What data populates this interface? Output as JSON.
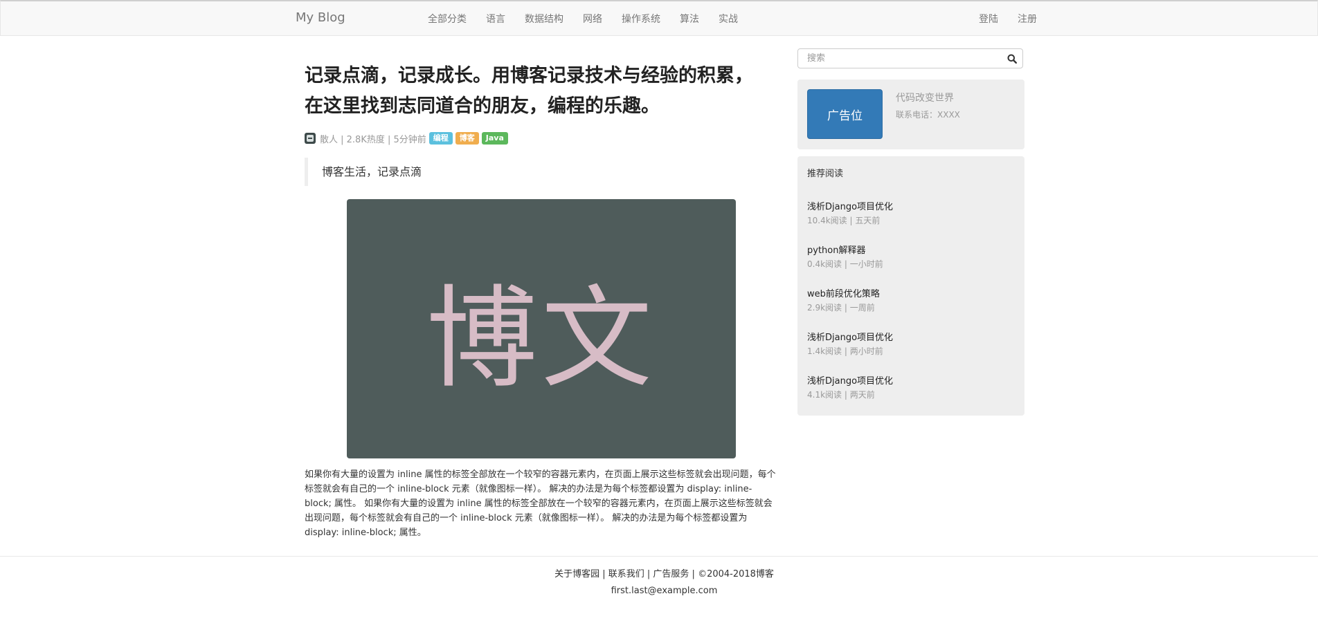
{
  "navbar": {
    "brand": "My Blog",
    "links": [
      "全部分类",
      "语言",
      "数据结构",
      "网络",
      "操作系统",
      "算法",
      "实战"
    ],
    "right": [
      "登陆",
      "注册"
    ]
  },
  "article": {
    "title_line1": "记录点滴，记录成长。用博客记录技术与经验的积累，",
    "title_line2": "在这里找到志同道合的朋友，编程的乐趣。",
    "meta": "散人 | 2.8K热度 | 5分钟前",
    "tags": [
      "编程",
      "博客",
      "Java"
    ],
    "quote": "博客生活，记录点滴",
    "hero_text": "博文",
    "body": "如果你有大量的设置为 inline 属性的标签全部放在一个较窄的容器元素内，在页面上展示这些标签就会出现问题，每个标签就会有自己的一个 inline-block 元素（就像图标一样）。 解决的办法是为每个标签都设置为 display: inline-block; 属性。 如果你有大量的设置为 inline 属性的标签全部放在一个较窄的容器元素内，在页面上展示这些标签就会出现问题，每个标签就会有自己的一个 inline-block 元素（就像图标一样）。 解决的办法是为每个标签都设置为 display: inline-block; 属性。"
  },
  "search": {
    "placeholder": "搜索",
    "icon": "search-icon"
  },
  "ad": {
    "box": "广告位",
    "title": "代码改变世界",
    "phone": "联系电话：XXXX"
  },
  "recommend": {
    "title": "推荐阅读",
    "items": [
      {
        "title": "浅析Django项目优化",
        "stats": "10.4k阅读 | 五天前"
      },
      {
        "title": "python解释器",
        "stats": "0.4k阅读 | 一小时前"
      },
      {
        "title": "web前段优化策略",
        "stats": "2.9k阅读 | 一周前"
      },
      {
        "title": "浅析Django项目优化",
        "stats": "1.4k阅读 | 两小时前"
      },
      {
        "title": "浅析Django项目优化",
        "stats": "4.1k阅读 | 两天前"
      }
    ]
  },
  "footer": {
    "links": [
      "关于博客园",
      "联系我们",
      "广告服务",
      "©2004-2018博客"
    ],
    "email": "first.last@example.com"
  }
}
